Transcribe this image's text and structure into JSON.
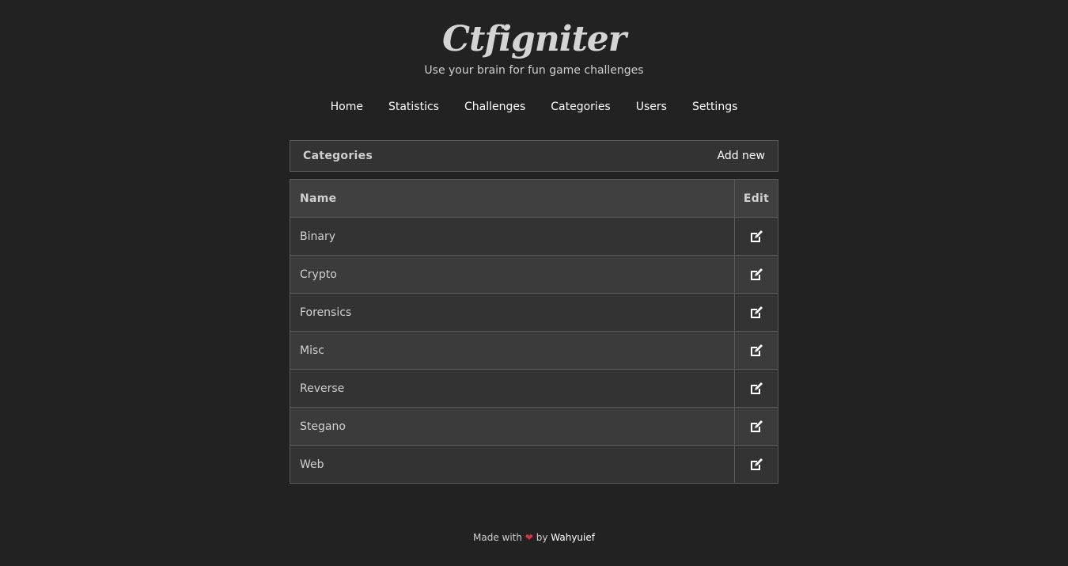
{
  "site": {
    "title": "Ctfigniter",
    "tagline": "Use your brain for fun game challenges"
  },
  "nav": {
    "items": [
      {
        "label": "Home"
      },
      {
        "label": "Statistics"
      },
      {
        "label": "Challenges"
      },
      {
        "label": "Categories"
      },
      {
        "label": "Users"
      },
      {
        "label": "Settings"
      }
    ]
  },
  "panel": {
    "title": "Categories",
    "add_label": "Add new"
  },
  "table": {
    "columns": [
      "Name",
      "Edit"
    ],
    "rows": [
      {
        "name": "Binary",
        "icon": "edit-icon"
      },
      {
        "name": "Crypto",
        "icon": "edit-icon"
      },
      {
        "name": "Forensics",
        "icon": "edit-icon"
      },
      {
        "name": "Misc",
        "icon": "edit-icon"
      },
      {
        "name": "Reverse",
        "icon": "edit-icon"
      },
      {
        "name": "Stegano",
        "icon": "edit-icon"
      },
      {
        "name": "Web",
        "icon": "edit-icon"
      }
    ]
  },
  "footer": {
    "made_with": "Made with",
    "by": "by",
    "author": "Wahyuief",
    "heart_color": "#e0313a"
  },
  "colors": {
    "background": "#222222",
    "panel": "#333333",
    "row_alt": "#3b3b3b",
    "header_row": "#404040",
    "border": "#5a5a5a"
  }
}
